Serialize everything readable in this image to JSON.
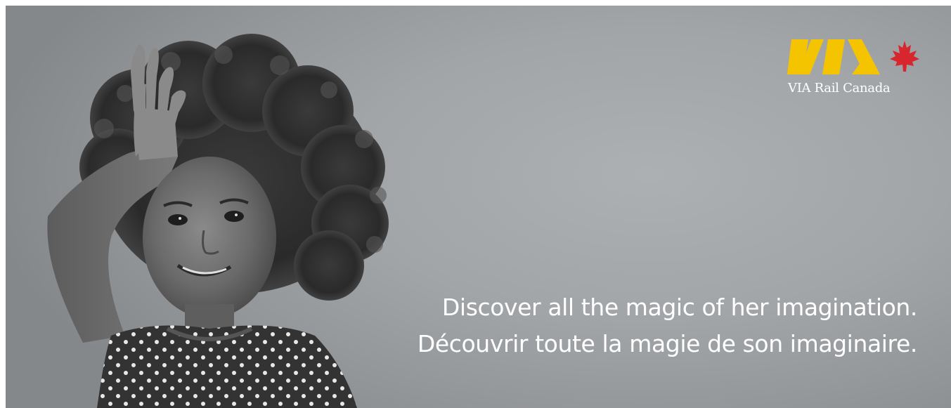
{
  "brand": {
    "logo_mark": "VIA",
    "logo_name": "VIA Rail Canada",
    "logo_color": "#f5c400",
    "leaf_color": "#d8262e"
  },
  "photo": {
    "icon": "girl-waving-photo"
  },
  "tagline": {
    "english": "Discover all the magic of her imagination.",
    "french": "Découvrir toute la magie de son imaginaire."
  }
}
